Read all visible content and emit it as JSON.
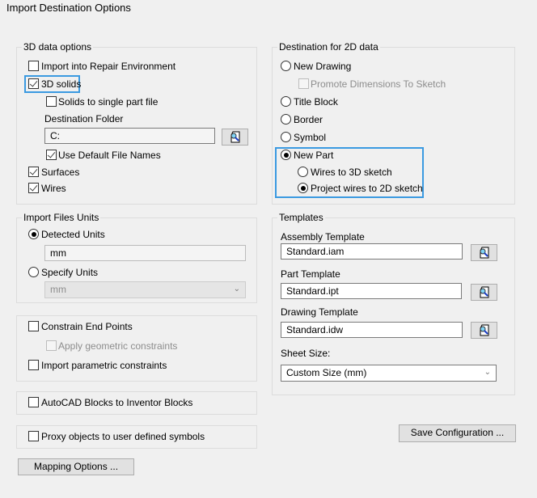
{
  "window": {
    "title": "Import Destination Options"
  },
  "data3d": {
    "title": "3D data options",
    "import_repair": {
      "label": "Import into Repair Environment",
      "checked": false
    },
    "solids": {
      "label": "3D solids",
      "checked": true
    },
    "single_part": {
      "label": "Solids to single part file",
      "checked": false
    },
    "dest_folder_label": "Destination Folder",
    "dest_folder_value": "C:",
    "use_default_names": {
      "label": "Use Default File Names",
      "checked": true
    },
    "surfaces": {
      "label": "Surfaces",
      "checked": true
    },
    "wires": {
      "label": "Wires",
      "checked": true
    }
  },
  "dest2d": {
    "title": "Destination for 2D data",
    "new_drawing": "New Drawing",
    "promote": "Promote Dimensions To Sketch",
    "title_block": "Title Block",
    "border": "Border",
    "symbol": "Symbol",
    "new_part": "New Part",
    "wires_3d": "Wires to 3D sketch",
    "project_2d": "Project wires to 2D sketch",
    "selected": "New Part",
    "sub_selected": "Project wires to 2D sketch"
  },
  "units": {
    "title": "Import Files Units",
    "detected": "Detected Units",
    "detected_value": "mm",
    "specify": "Specify Units",
    "specify_value": "mm"
  },
  "constraints": {
    "end_points": "Constrain End Points",
    "geometric": "Apply geometric constraints",
    "parametric": "Import parametric constraints"
  },
  "autocad_blocks": "AutoCAD Blocks to Inventor Blocks",
  "proxy": "Proxy objects to user defined symbols",
  "mapping_button": "Mapping Options ...",
  "templates": {
    "title": "Templates",
    "assembly_label": "Assembly Template",
    "assembly_value": "Standard.iam",
    "part_label": "Part Template",
    "part_value": "Standard.ipt",
    "drawing_label": "Drawing Template",
    "drawing_value": "Standard.idw",
    "sheet_label": "Sheet Size:",
    "sheet_value": "Custom Size (mm)"
  },
  "save_button": "Save Configuration ...",
  "accent": "#3b9ae1"
}
